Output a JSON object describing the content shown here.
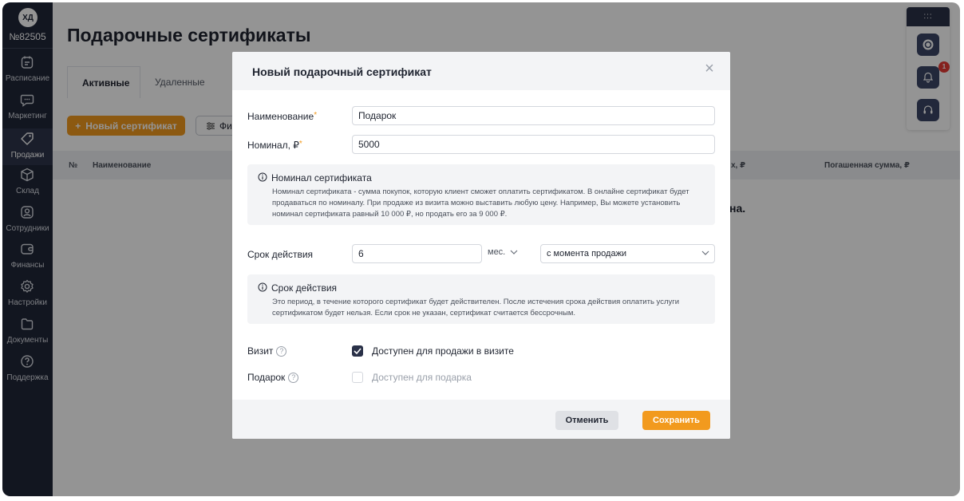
{
  "user": {
    "initials": "ХД",
    "id": "№82505"
  },
  "sidebar": {
    "items": [
      {
        "label": "Расписание",
        "icon": "calendar-icon"
      },
      {
        "label": "Маркетинг",
        "icon": "chat-icon"
      },
      {
        "label": "Продажи",
        "icon": "tag-icon",
        "active": true
      },
      {
        "label": "Склад",
        "icon": "box-icon"
      },
      {
        "label": "Сотрудники",
        "icon": "person-icon"
      },
      {
        "label": "Финансы",
        "icon": "wallet-icon"
      },
      {
        "label": "Настройки",
        "icon": "gear-icon"
      },
      {
        "label": "Документы",
        "icon": "folder-icon"
      },
      {
        "label": "Поддержка",
        "icon": "question-icon"
      }
    ]
  },
  "page": {
    "title": "Подарочные сертификаты",
    "tabs": [
      {
        "label": "Активные",
        "active": true
      },
      {
        "label": "Удаленные"
      }
    ],
    "new_button": "Новый сертификат",
    "filter_button": "Фи",
    "table_headers": [
      "№",
      "Наименование",
      "х, ₽",
      "Погашенная сумма, ₽"
    ],
    "empty_text_fragment": "на."
  },
  "widget": {
    "top": ":::",
    "notification_count": "1"
  },
  "modal": {
    "title": "Новый подарочный сертификат",
    "close": "×",
    "name_label": "Наименование",
    "name_value": "Подарок",
    "nominal_label": "Номинал, ₽",
    "nominal_value": "5000",
    "required_mark": "*",
    "info1": {
      "title": "Номинал сертификата",
      "text": "Номинал сертификата - сумма покупок, которую клиент сможет оплатить сертификатом. В онлайне сертификат будет продаваться по номиналу. При продаже из визита можно выставить любую цену. Например, Вы можете установить номинал сертификата равный 10 000 ₽, но продать его за 9 000 ₽."
    },
    "validity_label": "Срок действия",
    "validity_value": "6",
    "validity_unit": "мес.",
    "validity_from": "с момента продажи",
    "info2": {
      "title": "Срок действия",
      "text": "Это период, в течение которого сертификат будет действителен. После истечения срока действия оплатить услуги сертификатом будет нельзя. Если срок не указан, сертификат считается бессрочным."
    },
    "visit_label": "Визит",
    "visit_checkbox_label": "Доступен для продажи в визите",
    "visit_checked": true,
    "gift_label": "Подарок",
    "gift_checkbox_label": "Доступен для подарка",
    "gift_checked": false,
    "help_glyph": "?",
    "cancel_label": "Отменить",
    "save_label": "Сохранить"
  },
  "colors": {
    "accent": "#f29a1e",
    "sidebar": "#202638",
    "badge": "#e53935"
  }
}
